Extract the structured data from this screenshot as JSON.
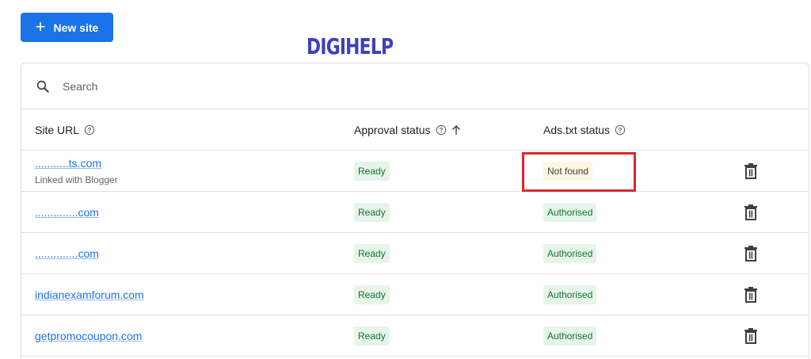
{
  "toolbar": {
    "new_site_plus": "+",
    "new_site_label": "New site"
  },
  "watermark": "DIGIHELP",
  "search": {
    "placeholder": "Search",
    "value": ""
  },
  "table": {
    "columns": {
      "site_url": "Site URL",
      "approval_status": "Approval status",
      "ads_txt_status": "Ads.txt status"
    },
    "rows": [
      {
        "url": "...........ts.com",
        "sub": "Linked with Blogger",
        "approval": "Ready",
        "ads_txt": "Not found"
      },
      {
        "url": "..............com",
        "approval": "Ready",
        "ads_txt": "Authorised"
      },
      {
        "url": "..............com",
        "approval": "Ready",
        "ads_txt": "Authorised"
      },
      {
        "url": "indianexamforum.com",
        "approval": "Ready",
        "ads_txt": "Authorised"
      },
      {
        "url": "getpromocoupon.com",
        "approval": "Ready",
        "ads_txt": "Authorised"
      }
    ]
  },
  "colors": {
    "accent": "#1a73e8",
    "ready_bg": "#e6f4ea",
    "not_found_bg": "#fef7e0",
    "highlight": "#e0242e"
  },
  "icons": {
    "search": "search-icon",
    "help": "help-icon",
    "sort": "arrow-up-icon",
    "delete": "trash-icon"
  }
}
